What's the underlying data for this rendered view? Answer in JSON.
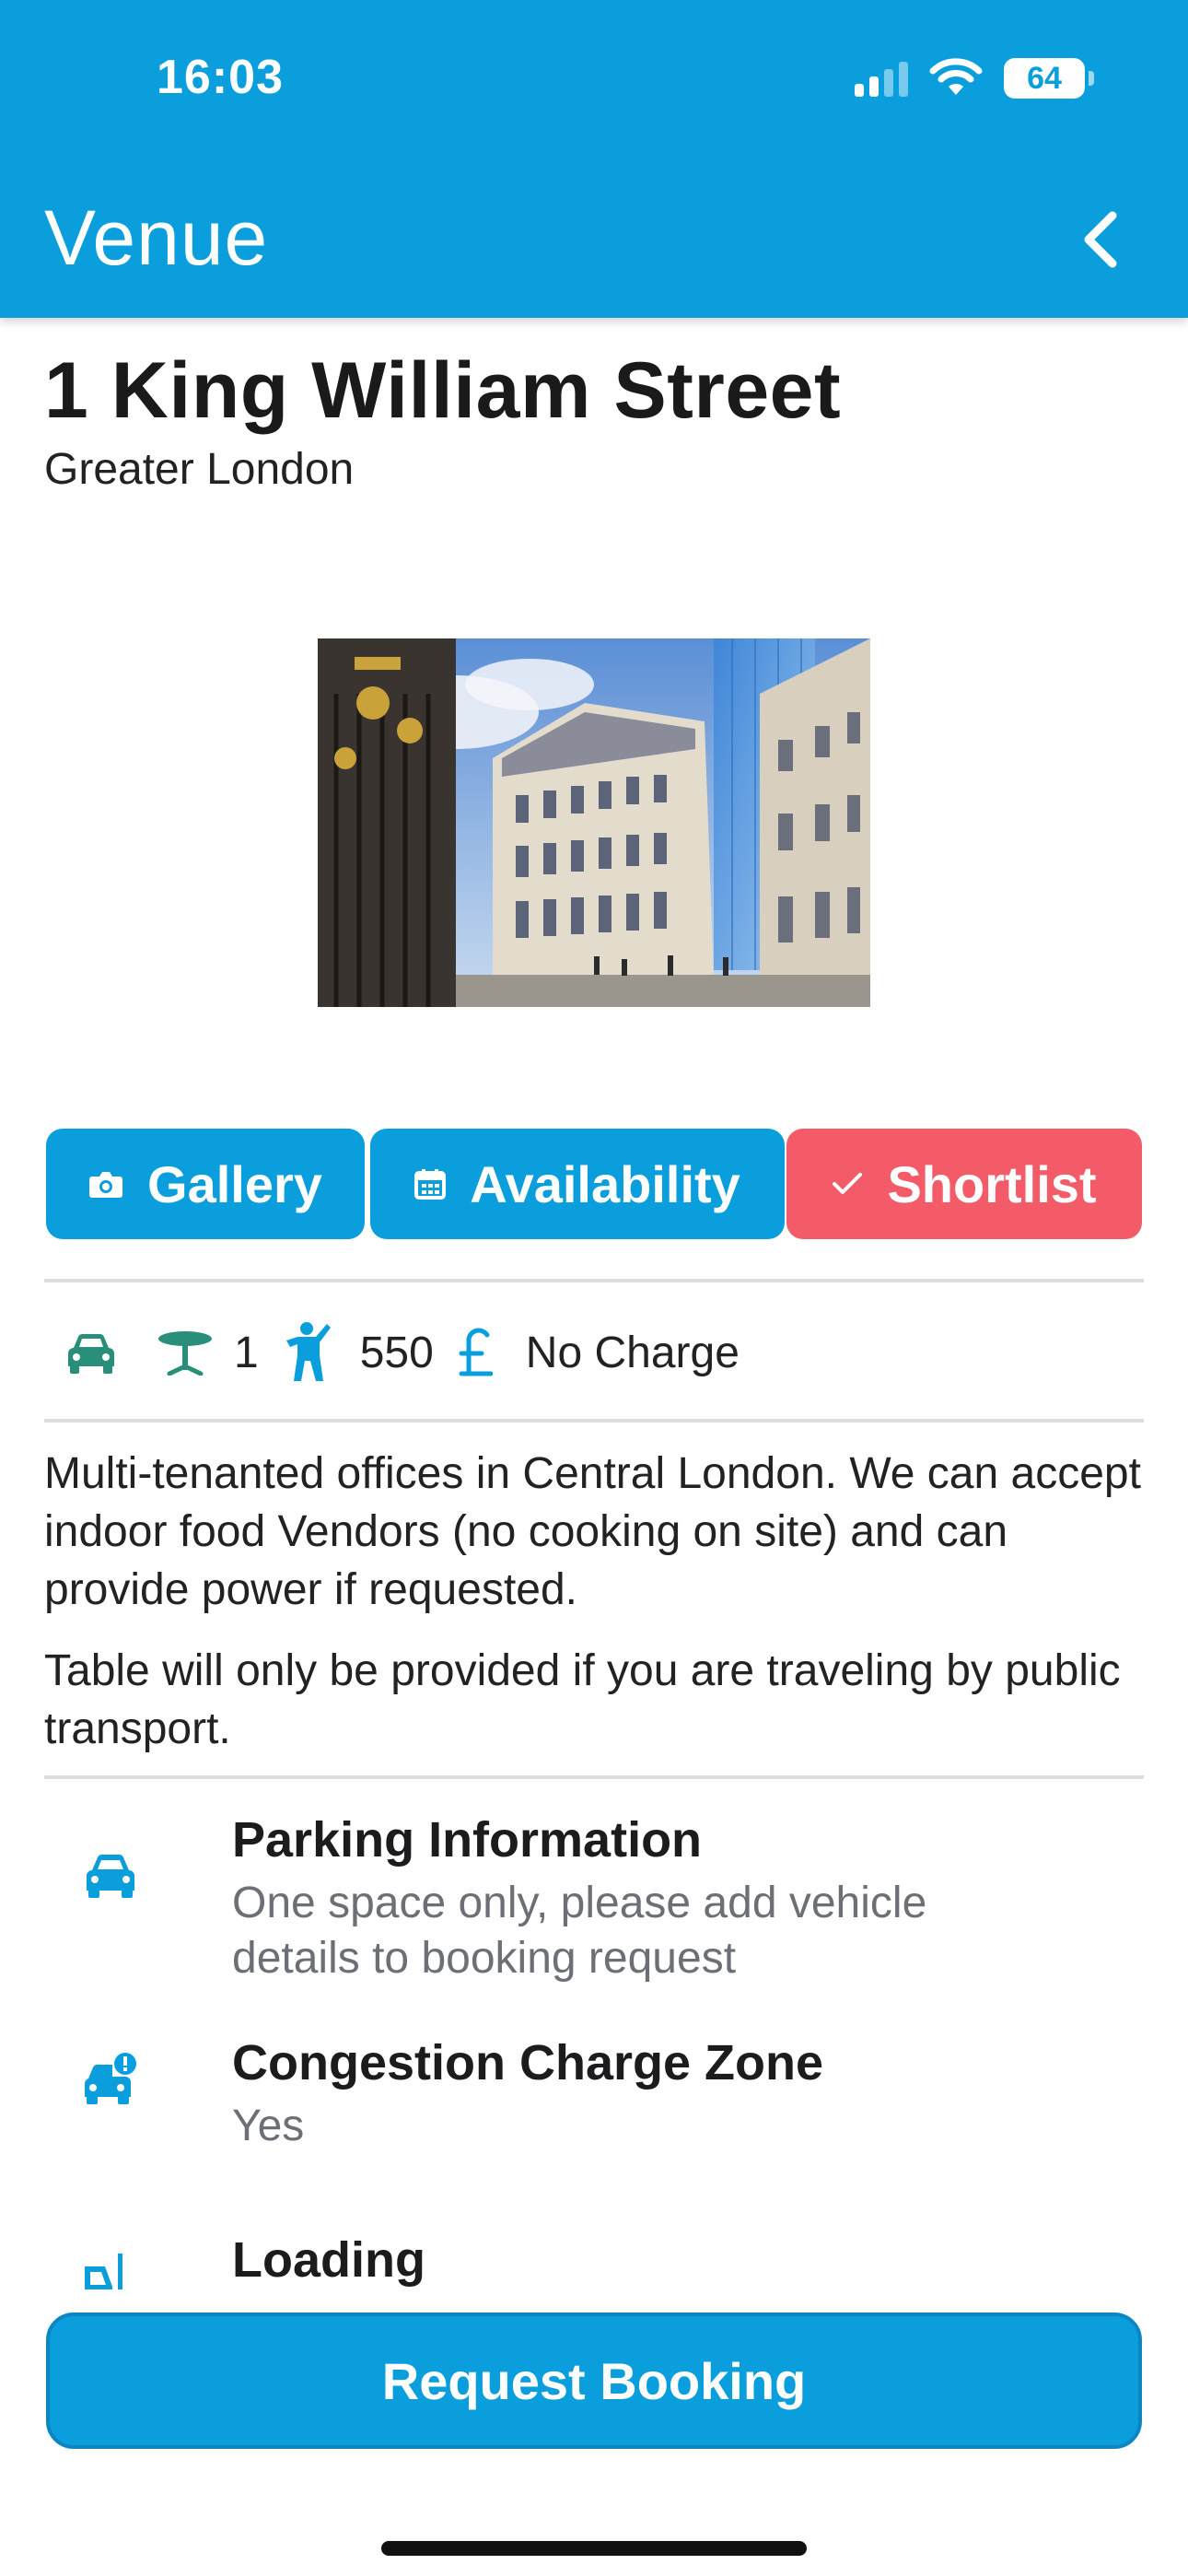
{
  "status_bar": {
    "time": "16:03",
    "battery": "64"
  },
  "header": {
    "title": "Venue"
  },
  "venue": {
    "name": "1 King William Street",
    "region": "Greater London"
  },
  "actions": {
    "gallery_label": "Gallery",
    "availability_label": "Availability",
    "shortlist_label": "Shortlist"
  },
  "stats": {
    "tables": "1",
    "footfall": "550",
    "charge": "No Charge",
    "icons": [
      "car-icon",
      "table-icon",
      "person-icon",
      "pound-icon"
    ]
  },
  "description": [
    "Multi-tenanted offices in Central London. We can accept indoor food Vendors (no cooking on site) and can provide power if requested.",
    "Table will only be provided if you are traveling by public transport."
  ],
  "info": [
    {
      "title": "Parking Information",
      "subtitle": "One space only, please add vehicle details to booking request",
      "icon": "car-icon"
    },
    {
      "title": "Congestion Charge Zone",
      "subtitle": "Yes",
      "icon": "car-alert-icon"
    },
    {
      "title": "Loading",
      "subtitle": "",
      "icon": "forklift-icon"
    }
  ],
  "cta": {
    "label": "Request Booking"
  },
  "colors": {
    "primary": "#0a9fdc",
    "shortlist": "#f45b68",
    "teal": "#2a8f7a"
  }
}
